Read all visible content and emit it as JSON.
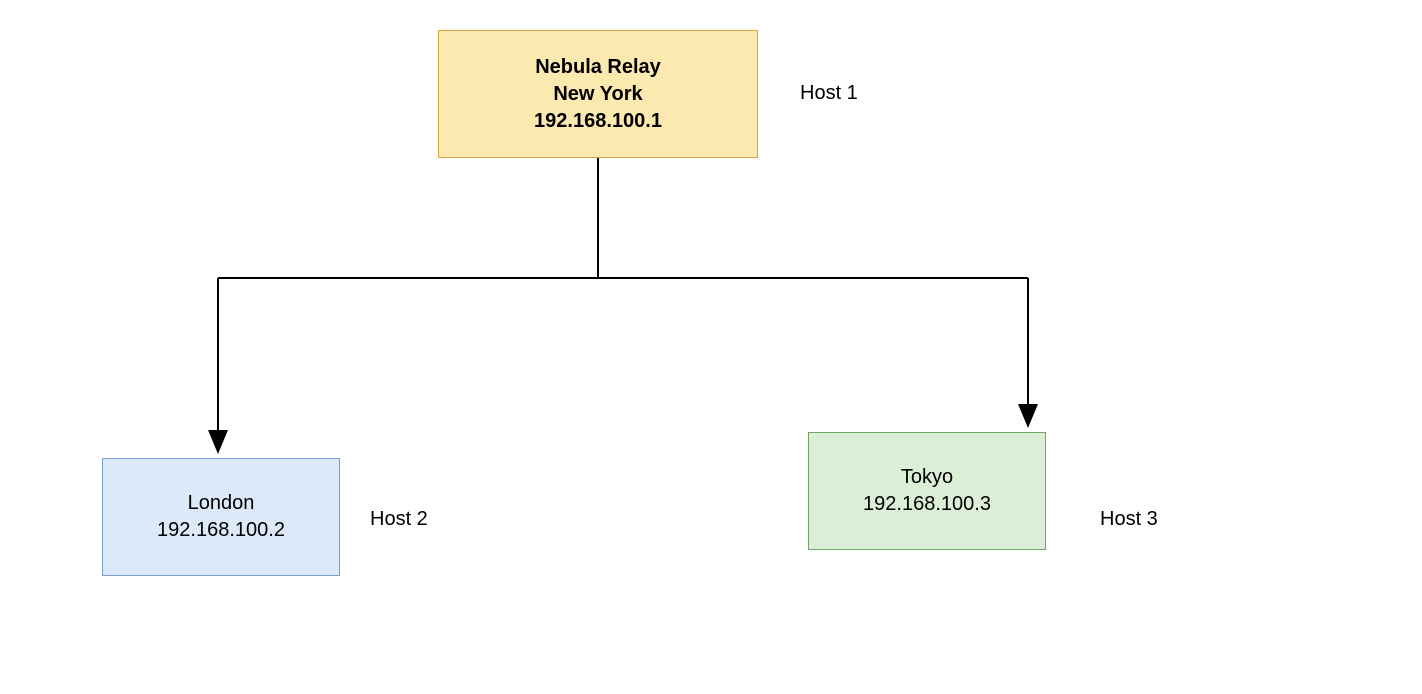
{
  "nodes": {
    "relay": {
      "title": "Nebula Relay",
      "location": "New York",
      "ip": "192.168.100.1",
      "host_label": "Host 1"
    },
    "london": {
      "location": "London",
      "ip": "192.168.100.2",
      "host_label": "Host 2"
    },
    "tokyo": {
      "location": "Tokyo",
      "ip": "192.168.100.3",
      "host_label": "Host 3"
    }
  }
}
